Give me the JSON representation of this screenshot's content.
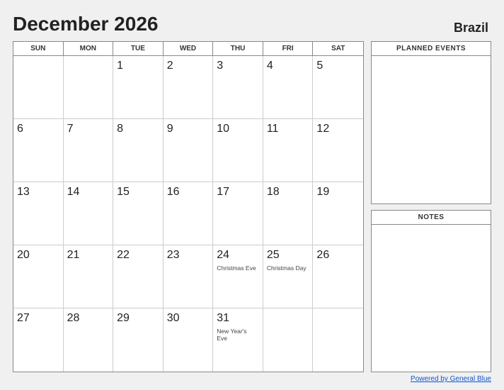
{
  "header": {
    "title": "December 2026",
    "country": "Brazil"
  },
  "day_headers": [
    "SUN",
    "MON",
    "TUE",
    "WED",
    "THU",
    "FRI",
    "SAT"
  ],
  "calendar": {
    "weeks": [
      [
        {
          "day": "",
          "empty": true
        },
        {
          "day": "",
          "empty": true
        },
        {
          "day": "1",
          "empty": false
        },
        {
          "day": "2",
          "empty": false
        },
        {
          "day": "3",
          "empty": false
        },
        {
          "day": "4",
          "empty": false
        },
        {
          "day": "5",
          "empty": false
        }
      ],
      [
        {
          "day": "6",
          "empty": false
        },
        {
          "day": "7",
          "empty": false
        },
        {
          "day": "8",
          "empty": false
        },
        {
          "day": "9",
          "empty": false
        },
        {
          "day": "10",
          "empty": false
        },
        {
          "day": "11",
          "empty": false
        },
        {
          "day": "12",
          "empty": false
        }
      ],
      [
        {
          "day": "13",
          "empty": false
        },
        {
          "day": "14",
          "empty": false
        },
        {
          "day": "15",
          "empty": false
        },
        {
          "day": "16",
          "empty": false
        },
        {
          "day": "17",
          "empty": false
        },
        {
          "day": "18",
          "empty": false
        },
        {
          "day": "19",
          "empty": false
        }
      ],
      [
        {
          "day": "20",
          "empty": false
        },
        {
          "day": "21",
          "empty": false
        },
        {
          "day": "22",
          "empty": false
        },
        {
          "day": "23",
          "empty": false
        },
        {
          "day": "24",
          "empty": false,
          "event": "Christmas Eve"
        },
        {
          "day": "25",
          "empty": false,
          "event": "Christmas Day"
        },
        {
          "day": "26",
          "empty": false
        }
      ],
      [
        {
          "day": "27",
          "empty": false
        },
        {
          "day": "28",
          "empty": false
        },
        {
          "day": "29",
          "empty": false
        },
        {
          "day": "30",
          "empty": false
        },
        {
          "day": "31",
          "empty": false,
          "event": "New Year's Eve"
        },
        {
          "day": "",
          "empty": true
        },
        {
          "day": "",
          "empty": true
        }
      ]
    ]
  },
  "planned_events": {
    "header": "PLANNED EVENTS"
  },
  "notes": {
    "header": "NOTES"
  },
  "footer": {
    "link_text": "Powered by General Blue",
    "link_url": "#"
  }
}
